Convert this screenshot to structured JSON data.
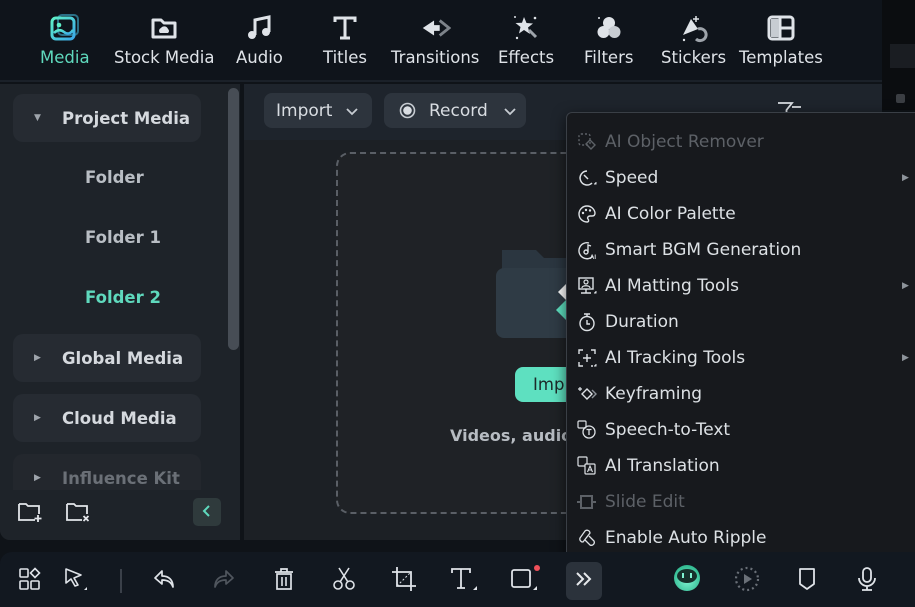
{
  "top_tabs": [
    {
      "label": "Media",
      "icon": "media-icon",
      "active": true
    },
    {
      "label": "Stock Media",
      "icon": "stock-media-icon",
      "active": false
    },
    {
      "label": "Audio",
      "icon": "music-note-icon",
      "active": false
    },
    {
      "label": "Titles",
      "icon": "titles-icon",
      "active": false
    },
    {
      "label": "Transitions",
      "icon": "transitions-icon",
      "active": false
    },
    {
      "label": "Effects",
      "icon": "effects-icon",
      "active": false
    },
    {
      "label": "Filters",
      "icon": "filters-icon",
      "active": false
    },
    {
      "label": "Stickers",
      "icon": "stickers-icon",
      "active": false
    },
    {
      "label": "Templates",
      "icon": "templates-icon",
      "active": false
    }
  ],
  "left_panel": {
    "sections": [
      {
        "label": "Project Media",
        "expanded": true
      },
      {
        "label": "Global Media",
        "expanded": false
      },
      {
        "label": "Cloud Media",
        "expanded": false
      },
      {
        "label": "Influence Kit",
        "expanded": false
      }
    ],
    "folders": [
      {
        "label": "Folder",
        "active": false
      },
      {
        "label": "Folder 1",
        "active": false
      },
      {
        "label": "Folder 2",
        "active": true
      }
    ],
    "new_folder_icon": "folder-add-icon",
    "delete_folder_icon": "folder-delete-icon",
    "collapse_icon": "chevron-left-icon"
  },
  "main": {
    "import_label": "Import",
    "record_label": "Record",
    "import_button_label": "Imp",
    "drop_hint": "Videos, audios"
  },
  "context_menu": [
    {
      "label": "AI Object Remover",
      "icon": "ai-object-remover-icon",
      "disabled": true,
      "submenu": false
    },
    {
      "label": "Speed",
      "icon": "speed-icon",
      "disabled": false,
      "submenu": true
    },
    {
      "label": "AI Color Palette",
      "icon": "palette-icon",
      "disabled": false,
      "submenu": false
    },
    {
      "label": "Smart BGM Generation",
      "icon": "smart-bgm-icon",
      "disabled": false,
      "submenu": false
    },
    {
      "label": "AI Matting Tools",
      "icon": "matting-icon",
      "disabled": false,
      "submenu": true
    },
    {
      "label": "Duration",
      "icon": "stopwatch-icon",
      "disabled": false,
      "submenu": false
    },
    {
      "label": "AI Tracking Tools",
      "icon": "tracking-icon",
      "disabled": false,
      "submenu": true
    },
    {
      "label": "Keyframing",
      "icon": "keyframe-icon",
      "disabled": false,
      "submenu": false
    },
    {
      "label": "Speech-to-Text",
      "icon": "speech-to-text-icon",
      "disabled": false,
      "submenu": false
    },
    {
      "label": "AI Translation",
      "icon": "translation-icon",
      "disabled": false,
      "submenu": false
    },
    {
      "label": "Slide Edit",
      "icon": "slide-edit-icon",
      "disabled": true,
      "submenu": false
    },
    {
      "label": "Enable Auto Ripple",
      "icon": "auto-ripple-icon",
      "disabled": false,
      "submenu": false
    }
  ],
  "bottom_toolbar": [
    {
      "name": "layout-icon"
    },
    {
      "name": "select-tool-icon"
    },
    {
      "name": "undo-icon"
    },
    {
      "name": "redo-icon",
      "disabled": true
    },
    {
      "name": "delete-icon"
    },
    {
      "name": "split-scissors-icon"
    },
    {
      "name": "crop-icon"
    },
    {
      "name": "text-tool-icon"
    },
    {
      "name": "shape-tool-icon",
      "notification": true
    },
    {
      "name": "more-tools-icon"
    },
    {
      "name": "ai-assistant-icon"
    },
    {
      "name": "render-preview-icon"
    },
    {
      "name": "marker-icon"
    },
    {
      "name": "microphone-icon"
    }
  ],
  "colors": {
    "accent": "#5fd9bd",
    "button_accent": "#5ee0c0",
    "notification": "#f0505a"
  }
}
